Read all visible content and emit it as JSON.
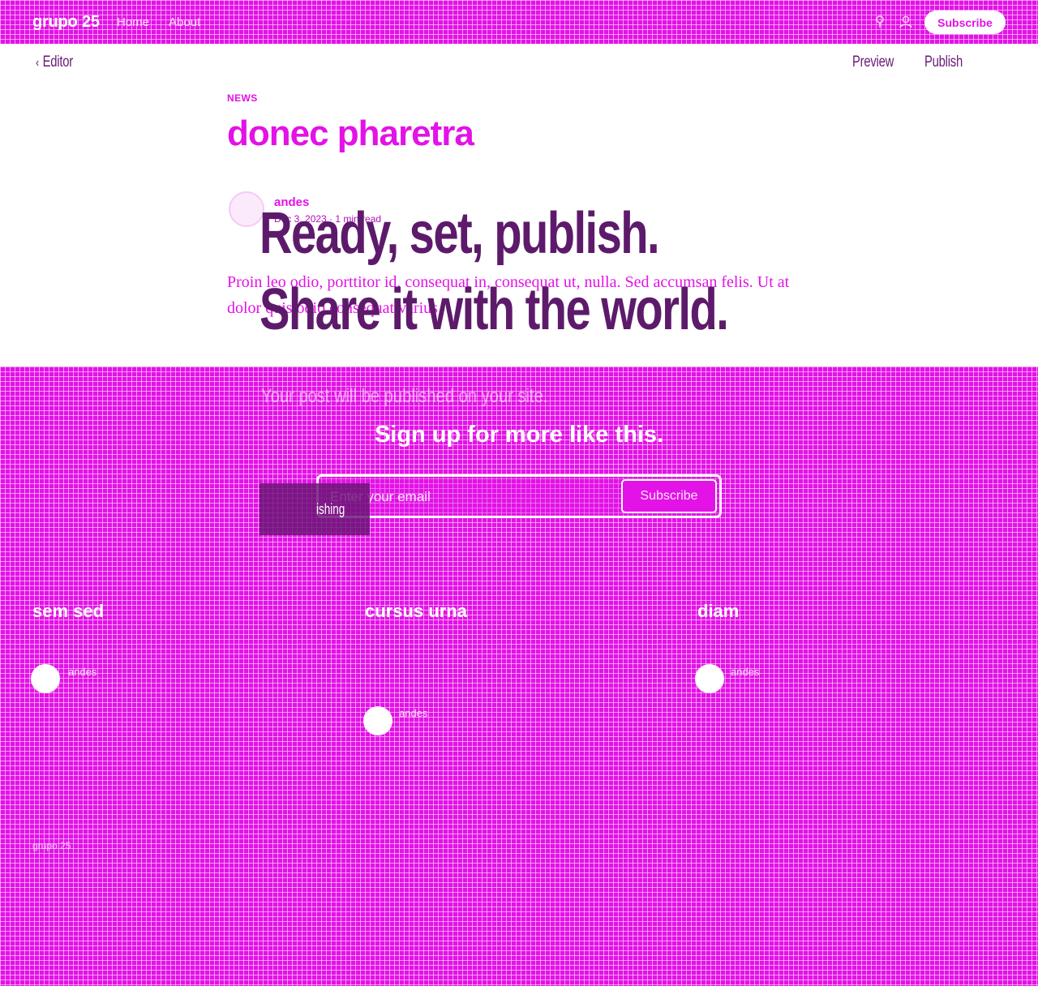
{
  "site": {
    "brand": "grupo 25",
    "nav": [
      "Home",
      "About"
    ],
    "subscribe_label": "Subscribe",
    "accent_color": "#e312e6"
  },
  "icons": {
    "search": "search-icon",
    "account": "account-icon",
    "back": "chevron-left-icon"
  },
  "editor": {
    "back_label": "Editor",
    "preview_label": "Preview",
    "publish_label": "Publish"
  },
  "post": {
    "tag": "NEWS",
    "title": "donec pharetra",
    "author": "andes",
    "meta": "Dec 3, 2023 · 1 min read",
    "excerpt": "Proin leo odio, porttitor id, consequat in, consequat ut, nulla. Sed accumsan felis. Ut at dolor quis odio consequat varius."
  },
  "overlay": {
    "line1": "Ready, set, publish.",
    "line2": "Share it with the world.",
    "sub": "Your post will be published on your site.",
    "publishing_label": "ishing"
  },
  "signup": {
    "heading": "Sign up for more like this.",
    "email_placeholder": "Enter your email",
    "button_label": "Subscribe"
  },
  "footer": {
    "columns": [
      {
        "title": "sem sed",
        "author": "andes"
      },
      {
        "title": "cursus urna",
        "author": "andes"
      },
      {
        "title": "diam",
        "author": "andes"
      }
    ],
    "copyright": "grupo 25"
  }
}
